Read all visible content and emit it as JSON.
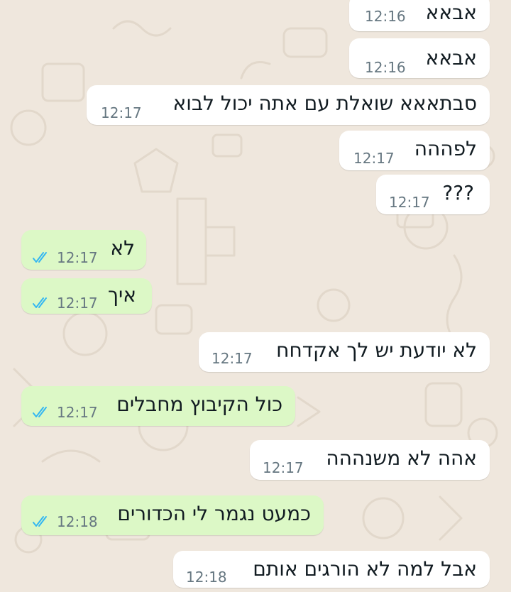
{
  "theme": {
    "incoming_bubble": "#ffffff",
    "outgoing_bubble": "#dcf8c6",
    "read_ticks": "#34b7f1",
    "wallpaper": "#efe7dd"
  },
  "messages": [
    {
      "direction": "incoming",
      "text": "אבאא",
      "time": "12:16"
    },
    {
      "direction": "incoming",
      "text": "אבאא",
      "time": "12:16"
    },
    {
      "direction": "incoming",
      "text": "סבתאאא שואלת עם אתה יכול לבוא",
      "time": "12:17"
    },
    {
      "direction": "incoming",
      "text": "לפההה",
      "time": "12:17"
    },
    {
      "direction": "incoming",
      "text": "???",
      "time": "12:17"
    },
    {
      "direction": "outgoing",
      "text": "לא",
      "time": "12:17",
      "status_icon": "read-double-check-icon"
    },
    {
      "direction": "outgoing",
      "text": "איך",
      "time": "12:17",
      "status_icon": "read-double-check-icon"
    },
    {
      "direction": "incoming",
      "text": "לא יודעת יש לך אקדחח",
      "time": "12:17"
    },
    {
      "direction": "outgoing",
      "text": "כול הקיבוץ מחבלים",
      "time": "12:17",
      "status_icon": "read-double-check-icon"
    },
    {
      "direction": "incoming",
      "text": "אהה לא משנההה",
      "time": "12:17"
    },
    {
      "direction": "outgoing",
      "text": "כמעט נגמר לי הכדורים",
      "time": "12:18",
      "status_icon": "read-double-check-icon"
    },
    {
      "direction": "incoming",
      "text": "אבל למה לא הורגים אותם",
      "time": "12:18"
    }
  ]
}
